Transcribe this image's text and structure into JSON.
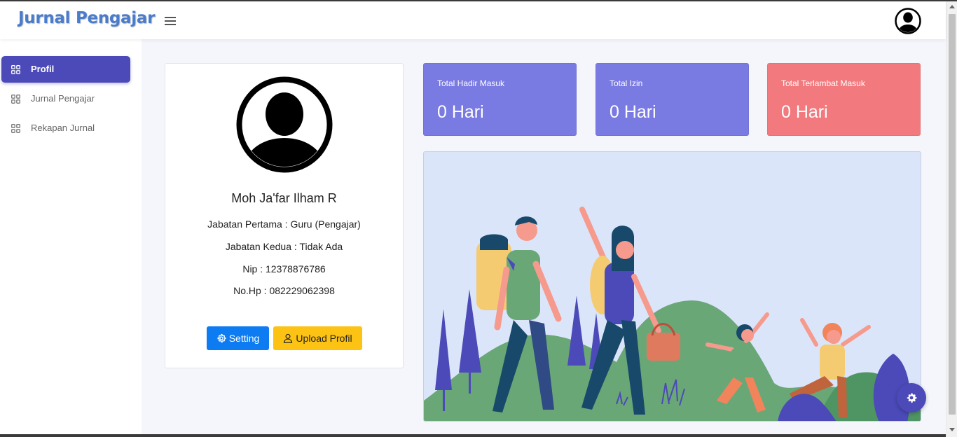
{
  "app": {
    "brand": "Jurnal Pengajar"
  },
  "sidebar": {
    "items": [
      {
        "label": "Profil",
        "active": true
      },
      {
        "label": "Jurnal Pengajar",
        "active": false
      },
      {
        "label": "Rekapan Jurnal",
        "active": false
      }
    ]
  },
  "profile": {
    "name": "Moh Ja'far Ilham R",
    "jabatan_pertama": "Jabatan Pertama : Guru (Pengajar)",
    "jabatan_kedua": "Jabatan Kedua : Tidak Ada",
    "nip": "Nip : 12378876786",
    "hp": "No.Hp : 082229062398",
    "setting_label": "Setting",
    "upload_label": "Upload Profil"
  },
  "stats": [
    {
      "title": "Total Hadir Masuk",
      "value": "0 Hari",
      "color": "#7a7ae3"
    },
    {
      "title": "Total Izin",
      "value": "0 Hari",
      "color": "#7a7ae3"
    },
    {
      "title": "Total Terlambat Masuk",
      "value": "0 Hari",
      "color": "#f27a7e"
    }
  ],
  "colors": {
    "accent": "#4b4ab8",
    "setting_button": "#0d7cf2",
    "upload_button": "#fcc314",
    "brand_text": "#4a7ccc"
  },
  "icons": {
    "menu": "hamburger-icon",
    "user": "user-avatar-icon",
    "nav": "grid-icon",
    "setting": "gear-icon",
    "upload": "user-outline-icon",
    "floating": "gear-icon"
  }
}
